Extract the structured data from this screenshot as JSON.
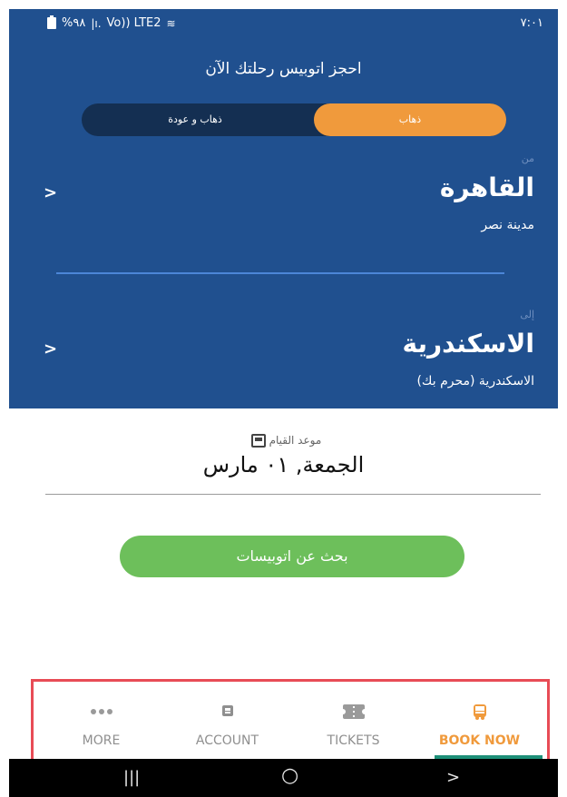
{
  "status": {
    "left": "%٩٨",
    "network": "Vo)) LTE2",
    "time": "٧:٠١"
  },
  "header": {
    "title": "احجز اتوبيس رحلتك الآن",
    "trip_type": {
      "round_trip": "ذهاب و عودة",
      "one_way": "ذهاب",
      "selected": "one_way"
    }
  },
  "from": {
    "label": "من",
    "city": "القاهرة",
    "station": "مدينة نصر",
    "chevron": ">"
  },
  "to": {
    "label": "إلى",
    "city": "الاسكندرية",
    "station": "الاسكندرية (محرم بك)",
    "chevron": ">"
  },
  "departure": {
    "label": "موعد القيام",
    "date": "الجمعة, ٠١ مارس"
  },
  "search_button": {
    "label": "بحث عن اتوبيسات"
  },
  "bottom_nav": {
    "items": [
      {
        "label": "MORE",
        "icon": "more-dots-icon"
      },
      {
        "label": "ACCOUNT",
        "icon": "account-card-icon"
      },
      {
        "label": "TICKETS",
        "icon": "ticket-icon"
      },
      {
        "label": "BOOK NOW",
        "icon": "bus-icon"
      }
    ],
    "active": "BOOK NOW"
  },
  "android_nav": {
    "recent": "|||",
    "home": "○",
    "back": ">"
  },
  "colors": {
    "header_bg": "#20508f",
    "toggle_bg": "#142f52",
    "accent_orange": "#f09a3c",
    "search_green": "#6dbf5b",
    "highlight_red": "#e84c56"
  }
}
